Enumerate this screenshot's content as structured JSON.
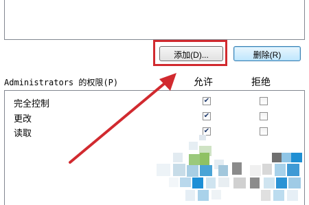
{
  "buttons": {
    "add_label": "添加(D)...",
    "remove_label": "删除(R)"
  },
  "permissions": {
    "header": "Administrators 的权限(P)",
    "col_allow": "允许",
    "col_deny": "拒绝",
    "rows": [
      {
        "label": "完全控制",
        "allow": true,
        "deny": false
      },
      {
        "label": "更改",
        "allow": true,
        "deny": false
      },
      {
        "label": "读取",
        "allow": true,
        "deny": false
      }
    ]
  },
  "annotation": {
    "highlight_color": "#d12a2f",
    "arrow_color": "#d12a2f"
  },
  "watermark": {
    "description": "pixelated mosaic logo watermark"
  }
}
